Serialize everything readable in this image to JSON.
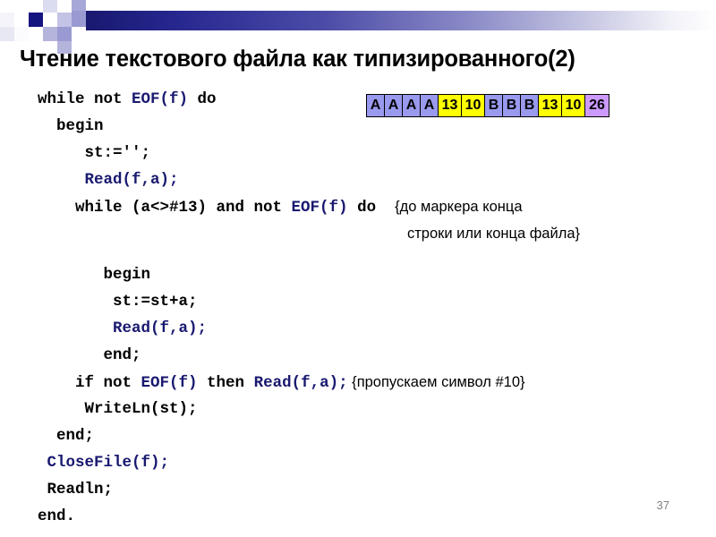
{
  "slide": {
    "title": "Чтение текстового файла как типизированного(2)",
    "page_number": "37"
  },
  "colors": {
    "gradient_start": "#191970",
    "gradient_end": "#ffffff",
    "keyword": "#000000",
    "function": "#191970",
    "byte_blue": "#9999ee",
    "byte_yellow": "#ffff00",
    "byte_purple": "#cc99ff",
    "page_number": "#808080"
  },
  "byte_diagram": {
    "name": "file-bytes-illustration",
    "cells": [
      {
        "label": "A",
        "color": "blue"
      },
      {
        "label": "A",
        "color": "blue"
      },
      {
        "label": "A",
        "color": "blue"
      },
      {
        "label": "A",
        "color": "blue"
      },
      {
        "label": "13",
        "color": "yellow"
      },
      {
        "label": "10",
        "color": "yellow"
      },
      {
        "label": "B",
        "color": "blue"
      },
      {
        "label": "B",
        "color": "blue"
      },
      {
        "label": "B",
        "color": "blue"
      },
      {
        "label": "13",
        "color": "yellow"
      },
      {
        "label": "10",
        "color": "yellow"
      },
      {
        "label": "26",
        "color": "purple"
      }
    ]
  },
  "code": {
    "line1_a": "while not ",
    "line1_b": "EOF(f)",
    "line1_c": " do",
    "line2": "  begin",
    "line3": "     st:='';",
    "line4": "     Read(f,a);",
    "line5_a": "    while (a<>#13) and not ",
    "line5_b": "EOF(f)",
    "line5_c": " do  ",
    "line5_comment": "{до маркера конца",
    "line6_comment": "строки или конца файла}",
    "line7": "       begin",
    "line8": "        st:=st+a;",
    "line9": "        Read(f,a);",
    "line10": "       end;",
    "line11_a": "    if not ",
    "line11_b": "EOF(f)",
    "line11_c": " then ",
    "line11_d": "Read(f,a);",
    "line11_comment": " {пропускаем символ #10}",
    "line12": "     WriteLn(st);",
    "line13": "  end;",
    "line14": " CloseFile(f);",
    "line15": " Readln;",
    "line16": "end."
  }
}
